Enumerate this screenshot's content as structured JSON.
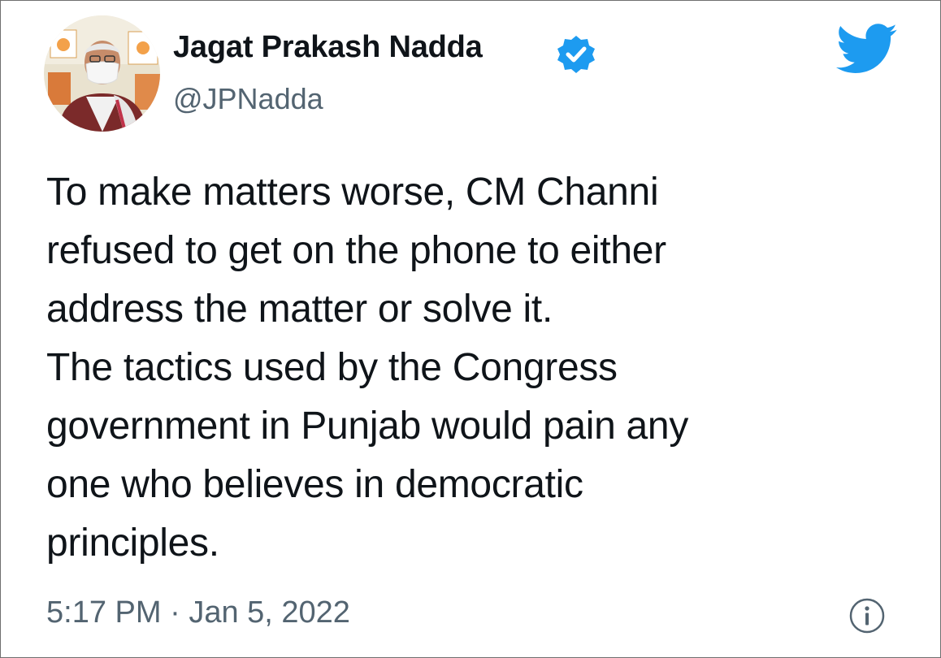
{
  "tweet": {
    "author": {
      "name": "Jagat Prakash Nadda",
      "handle": "@JPNadda",
      "verified": true,
      "avatar": "avatar-photo"
    },
    "text_lines": [
      "To make matters worse, CM Channi",
      "refused to get on the phone to either",
      "address the matter or solve it.",
      "The tactics used by the Congress",
      "government in Punjab would pain any",
      "one who believes in democratic",
      "principles."
    ],
    "time": "5:17 PM",
    "separator": "·",
    "date": "Jan 5, 2022"
  },
  "icons": {
    "brand": "twitter-bird-icon",
    "verified": "verified-badge-icon",
    "info": "info-icon"
  },
  "colors": {
    "twitter_blue": "#1d9bf0",
    "text_primary": "#0f1419",
    "text_secondary": "#536471"
  }
}
